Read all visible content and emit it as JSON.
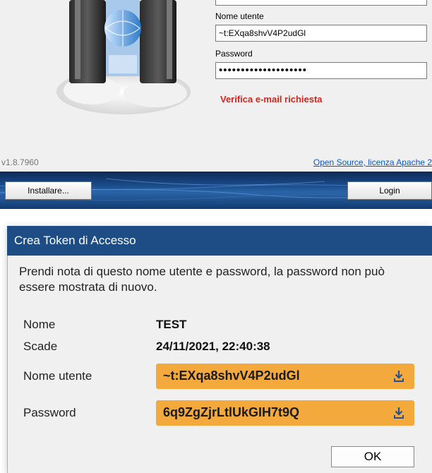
{
  "login": {
    "username_label": "Nome utente",
    "username_value": "~t:EXqa8shvV4P2udGl",
    "password_label": "Password",
    "password_dots": "••••••••••••••••••••",
    "warning": "Verifica e-mail richiesta",
    "version": "v1.8.7960",
    "license_link": "Open Source, licenza Apache 2",
    "install_button": "Installare...",
    "login_button": "Login"
  },
  "dialog": {
    "title": "Crea Token di Accesso",
    "intro": "Prendi nota di questo nome utente e password, la password non può essere mostrata di nuovo.",
    "name_label": "Nome",
    "name_value": "TEST",
    "expires_label": "Scade",
    "expires_value": "24/11/2021, 22:40:38",
    "username_label": "Nome utente",
    "username_value": "~t:EXqa8shvV4P2udGl",
    "password_label": "Password",
    "password_value": "6q9ZgZjrLtlUkGIH7t9Q",
    "ok_button": "OK"
  },
  "colors": {
    "accent_orange": "#f4a93c",
    "title_blue": "#1e4d86",
    "warning_red": "#d4241c",
    "link_blue": "#0b56c8"
  },
  "icons": [
    "server-icon",
    "download-icon"
  ]
}
